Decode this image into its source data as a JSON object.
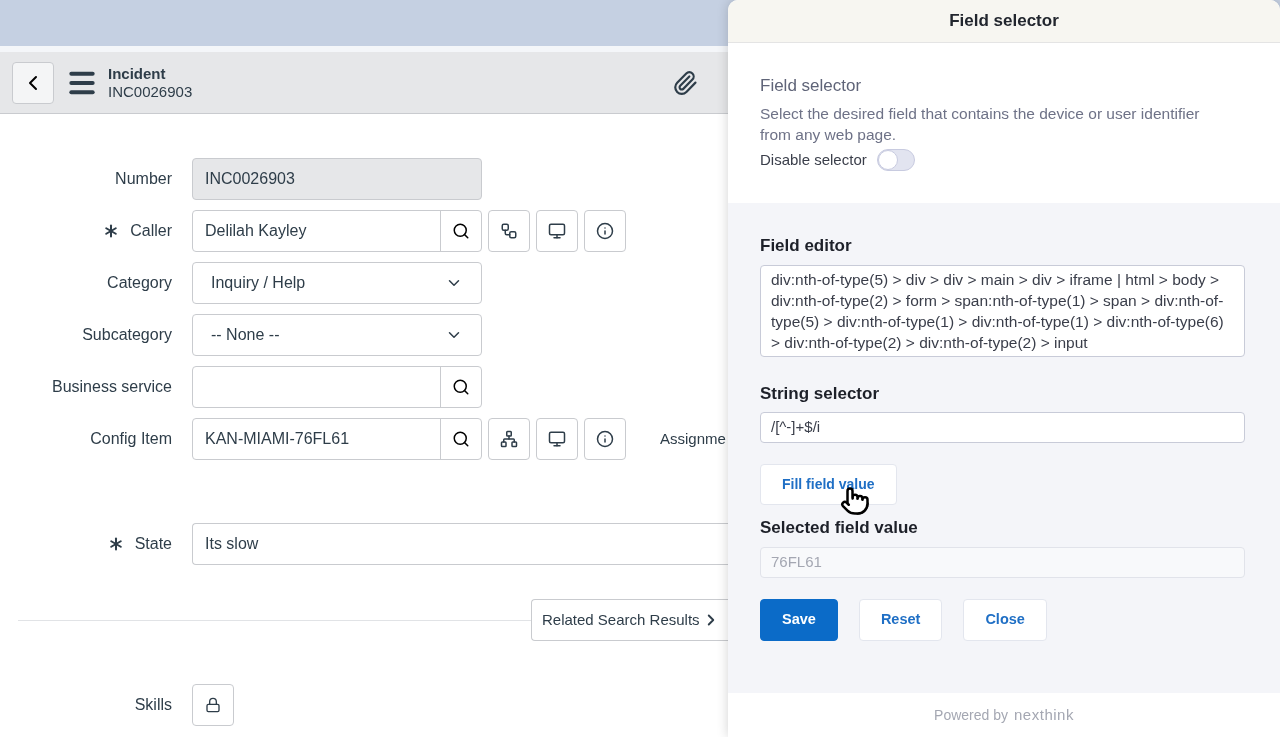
{
  "header": {
    "title": "Incident",
    "number": "INC0026903"
  },
  "fields": [
    {
      "label": "Number",
      "kind": "readonly",
      "required": false,
      "value": "INC0026903"
    },
    {
      "label": "Caller",
      "kind": "user_reference",
      "required": true,
      "value": "Delilah Kayley"
    },
    {
      "label": "Category",
      "kind": "choice",
      "required": false,
      "value": "Inquiry / Help"
    },
    {
      "label": "Subcategory",
      "kind": "choice",
      "required": false,
      "value": "-- None --"
    },
    {
      "label": "Business service",
      "kind": "reference",
      "required": false
    },
    {
      "label": "Config Item",
      "kind": "ci_reference",
      "required": false,
      "value": "KAN-MIAMI-76FL61",
      "side_label": "Assignme"
    },
    {
      "label": "State",
      "kind": "text",
      "required": true,
      "value": "Its slow"
    }
  ],
  "related_button": "Related Search Results",
  "skills": {
    "label": "Skills"
  },
  "panel": {
    "title": "Field selector",
    "subtitle": "Field selector",
    "description": "Select the desired field that contains the device or user identifier from any web page.",
    "toggle": {
      "label": "Disable selector",
      "on": false
    },
    "field_editor": {
      "label": "Field editor",
      "value": "div:nth-of-type(5) > div > div > main > div > iframe | html > body > div:nth-of-type(2) > form > span:nth-of-type(1) > span > div:nth-of-type(5) > div:nth-of-type(1) > div:nth-of-type(1) > div:nth-of-type(6) > div:nth-of-type(2) > div:nth-of-type(2) > input"
    },
    "string_selector": {
      "label": "String selector",
      "value": "/[^-]+$/i"
    },
    "fill_button": "Fill field value",
    "selected_value": {
      "label": "Selected field value",
      "value": "76FL61"
    },
    "buttons": [
      {
        "label": "Save",
        "kind": "primary"
      },
      {
        "label": "Reset",
        "kind": "secondary"
      },
      {
        "label": "Close",
        "kind": "secondary"
      }
    ],
    "footer": {
      "prefix": "Powered by",
      "brand": "nexthink"
    }
  }
}
